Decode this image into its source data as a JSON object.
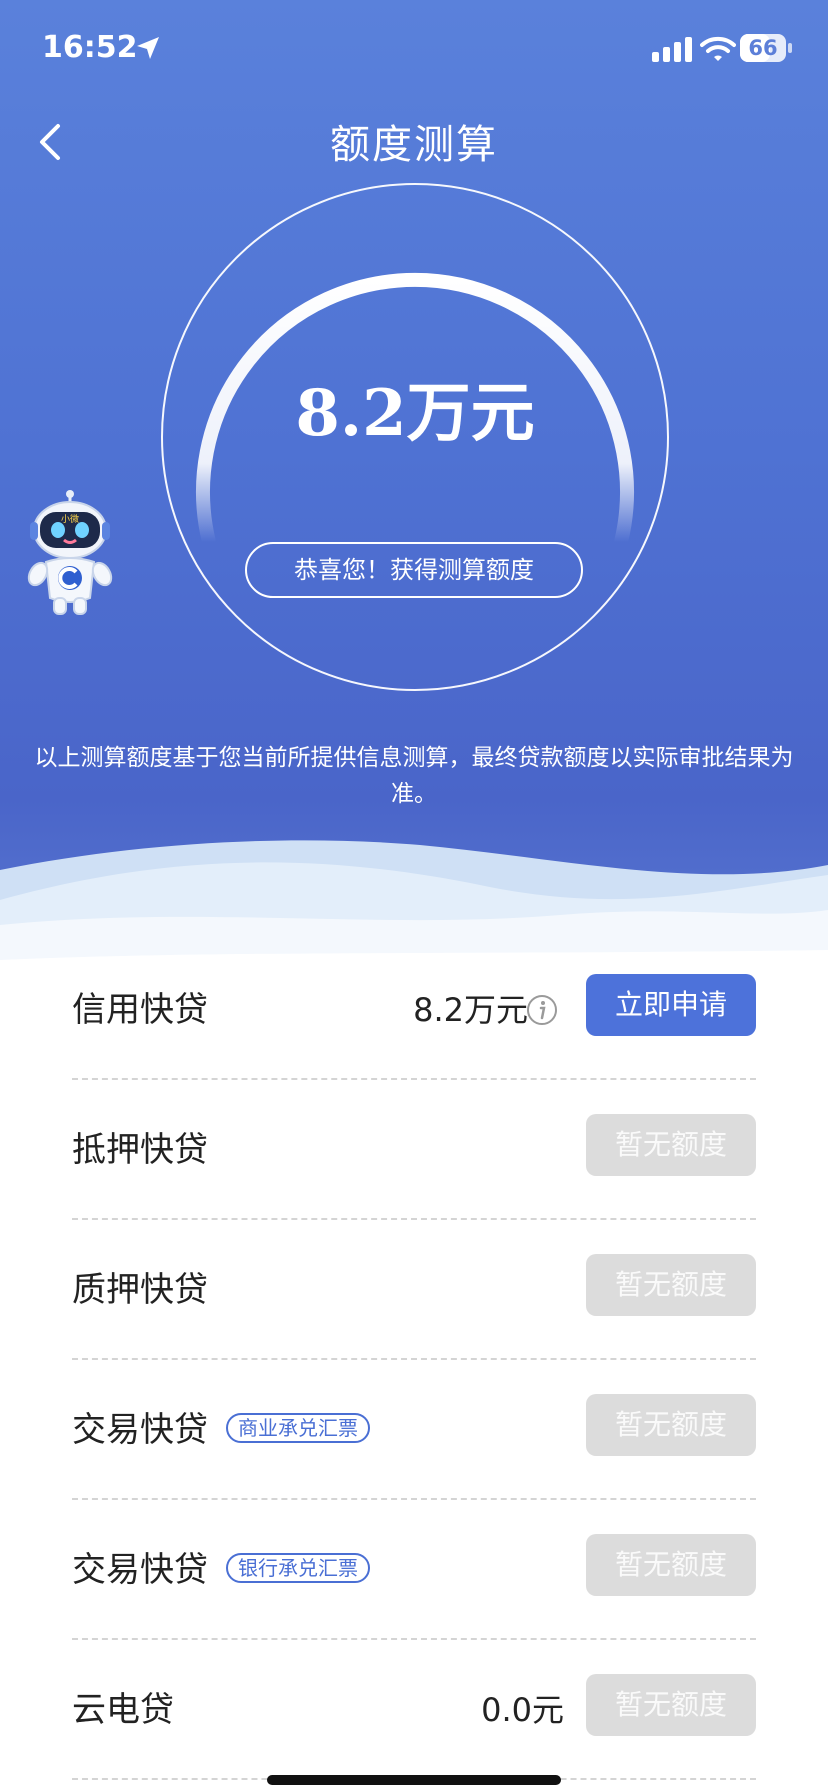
{
  "status": {
    "time": "16:52",
    "battery": "66",
    "battery_level": 0.66
  },
  "header": {
    "title": "额度测算"
  },
  "result": {
    "amount": "8.2万元",
    "congrats": "恭喜您！获得测算额度",
    "notice": "以上测算额度基于您当前所提供信息测算，最终贷款额度以实际审批结果为准。"
  },
  "products": [
    {
      "name": "信用快贷",
      "tag": "",
      "value": "8.2万元",
      "button": "立即申请",
      "enabled": true
    },
    {
      "name": "抵押快贷",
      "tag": "",
      "value": "",
      "button": "暂无额度",
      "enabled": false
    },
    {
      "name": "质押快贷",
      "tag": "",
      "value": "",
      "button": "暂无额度",
      "enabled": false
    },
    {
      "name": "交易快贷",
      "tag": "商业承兑汇票",
      "value": "",
      "button": "暂无额度",
      "enabled": false
    },
    {
      "name": "交易快贷",
      "tag": "银行承兑汇票",
      "value": "",
      "button": "暂无额度",
      "enabled": false
    },
    {
      "name": "云电贷",
      "tag": "",
      "value": "0.0元",
      "button": "暂无额度",
      "enabled": false
    }
  ],
  "robot": {
    "badge": "小微"
  },
  "icons": {
    "back": "chevron-left-icon",
    "location": "location-arrow-icon",
    "signal": "signal-icon",
    "wifi": "wifi-icon",
    "battery": "battery-icon",
    "info": "info-icon",
    "mascot": "robot-mascot"
  },
  "colors": {
    "primary": "#4d72da",
    "disabled": "#dcdcdc",
    "hero": "#5a81db"
  }
}
